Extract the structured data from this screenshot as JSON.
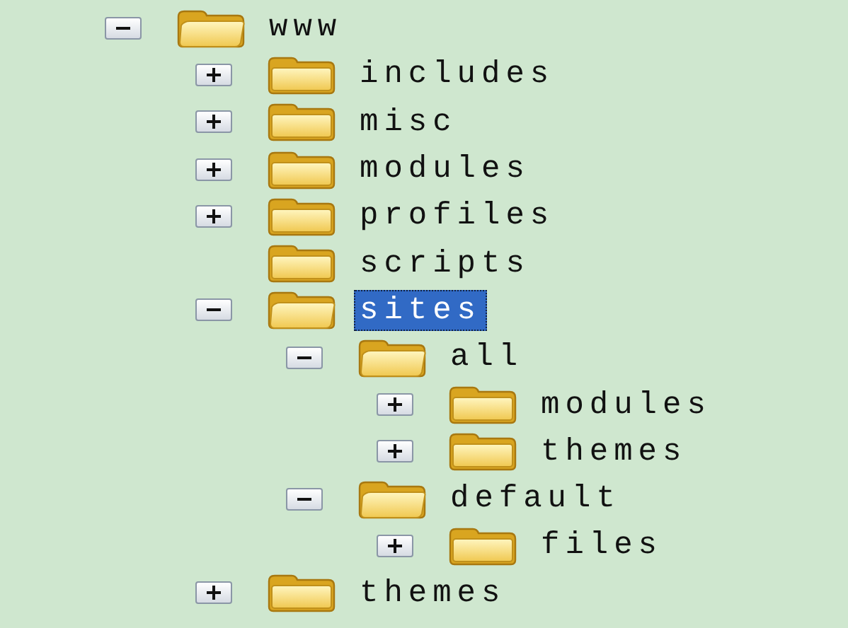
{
  "tree": [
    {
      "name": "www",
      "expandable": true,
      "expanded": true,
      "selected": false,
      "children": [
        {
          "name": "includes",
          "expandable": true,
          "expanded": false,
          "selected": false
        },
        {
          "name": "misc",
          "expandable": true,
          "expanded": false,
          "selected": false
        },
        {
          "name": "modules",
          "expandable": true,
          "expanded": false,
          "selected": false
        },
        {
          "name": "profiles",
          "expandable": true,
          "expanded": false,
          "selected": false
        },
        {
          "name": "scripts",
          "expandable": false,
          "expanded": false,
          "selected": false
        },
        {
          "name": "sites",
          "expandable": true,
          "expanded": true,
          "selected": true,
          "children": [
            {
              "name": "all",
              "expandable": true,
              "expanded": true,
              "selected": false,
              "children": [
                {
                  "name": "modules",
                  "expandable": true,
                  "expanded": false,
                  "selected": false
                },
                {
                  "name": "themes",
                  "expandable": true,
                  "expanded": false,
                  "selected": false
                }
              ]
            },
            {
              "name": "default",
              "expandable": true,
              "expanded": true,
              "selected": false,
              "children": [
                {
                  "name": "files",
                  "expandable": true,
                  "expanded": false,
                  "selected": false
                }
              ]
            }
          ]
        },
        {
          "name": "themes",
          "expandable": true,
          "expanded": false,
          "selected": false
        }
      ]
    }
  ]
}
